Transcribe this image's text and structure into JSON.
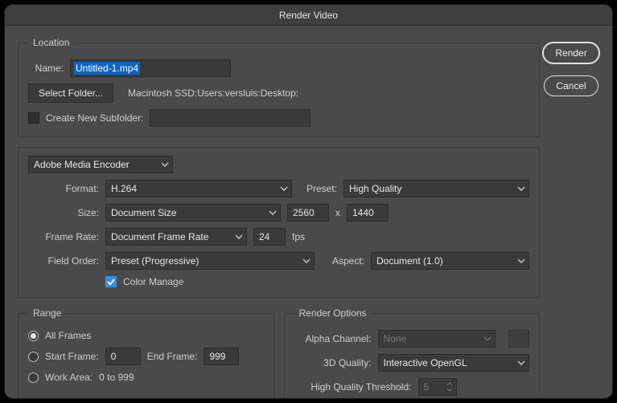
{
  "window": {
    "title": "Render Video"
  },
  "actions": {
    "render": "Render",
    "cancel": "Cancel"
  },
  "location": {
    "legend": "Location",
    "name_label": "Name:",
    "name_value": "Untitled-1.mp4",
    "select_folder": "Select Folder...",
    "path": "Macintosh SSD:Users:versluis:Desktop:",
    "create_subfolder": "Create New Subfolder:",
    "subfolder_value": ""
  },
  "encoder": {
    "engine": "Adobe Media Encoder",
    "format_label": "Format:",
    "format_value": "H.264",
    "preset_label": "Preset:",
    "preset_value": "High Quality",
    "size_label": "Size:",
    "size_mode": "Document Size",
    "width": "2560",
    "height": "1440",
    "x": "x",
    "fr_label": "Frame Rate:",
    "fr_mode": "Document Frame Rate",
    "fr_value": "24",
    "fps": "fps",
    "fo_label": "Field Order:",
    "fo_value": "Preset (Progressive)",
    "aspect_label": "Aspect:",
    "aspect_value": "Document (1.0)",
    "color_manage": "Color Manage"
  },
  "range": {
    "legend": "Range",
    "all": "All Frames",
    "start_label": "Start Frame:",
    "start_value": "0",
    "end_label": "End Frame:",
    "end_value": "999",
    "work_area": "Work Area:",
    "work_area_value": "0 to 999"
  },
  "render_options": {
    "legend": "Render Options",
    "alpha_label": "Alpha Channel:",
    "alpha_value": "None",
    "quality_label": "3D Quality:",
    "quality_value": "Interactive OpenGL",
    "hqt_label": "High Quality Threshold:",
    "hqt_value": "5"
  }
}
